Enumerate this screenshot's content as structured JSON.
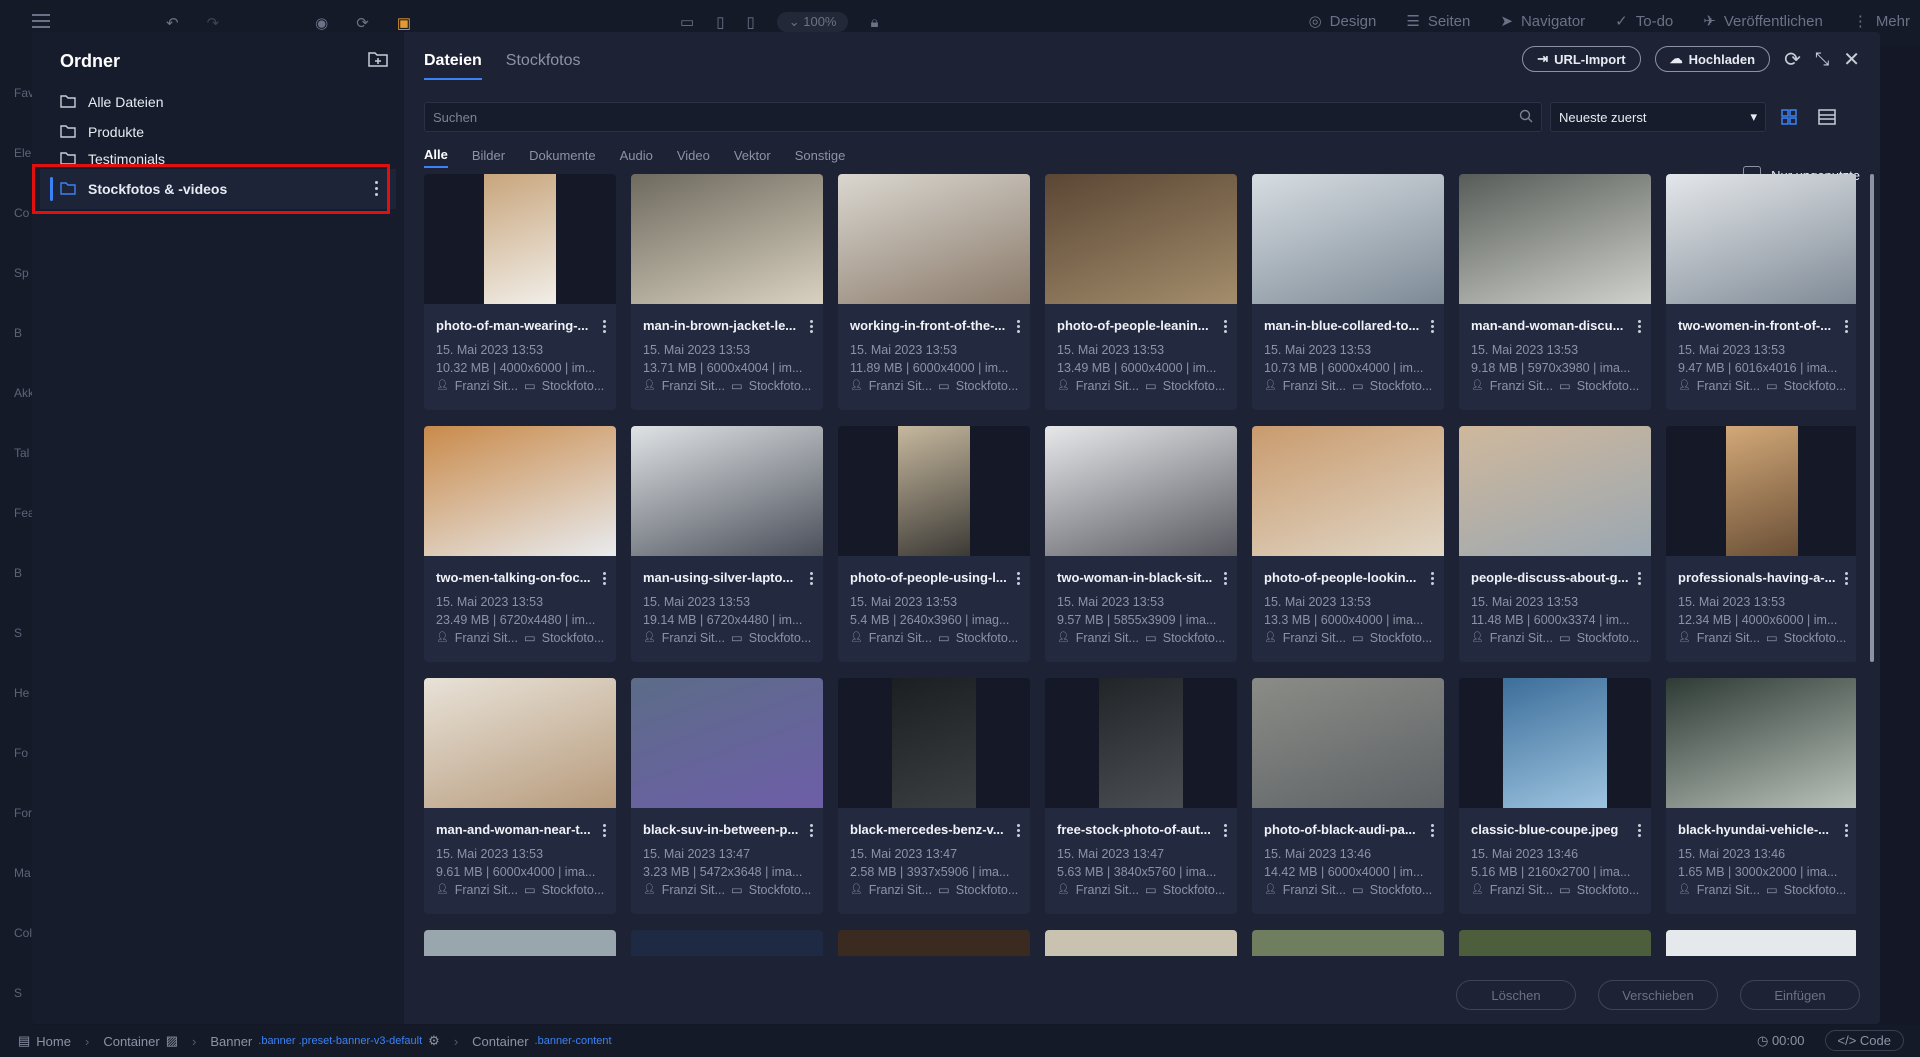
{
  "topbar": {
    "zoom": "100%",
    "items": [
      "Design",
      "Seiten",
      "Navigator",
      "To-do",
      "Veröffentlichen",
      "Mehr"
    ]
  },
  "leftrail": [
    "Fav",
    "Ele",
    "Co",
    "Sp",
    "B",
    "Akk",
    "Tal",
    "Fea",
    "B",
    "S",
    "He",
    "Fo",
    "For",
    "Ma",
    "Coll",
    "S"
  ],
  "folders": {
    "title": "Ordner",
    "items": [
      {
        "label": "Alle Dateien"
      },
      {
        "label": "Produkte"
      },
      {
        "label": "Testimonials"
      },
      {
        "label": "Stockfotos & -videos"
      }
    ]
  },
  "main": {
    "tabs": [
      "Dateien",
      "Stockfotos"
    ],
    "url_import": "URL-Import",
    "upload": "Hochladen",
    "search_placeholder": "Suchen",
    "sort": "Neueste zuerst",
    "filters": [
      "Alle",
      "Bilder",
      "Dokumente",
      "Audio",
      "Video",
      "Vektor",
      "Sonstige"
    ],
    "unused_label": "Nur ungenutzte"
  },
  "files": [
    {
      "name": "photo-of-man-wearing-...",
      "date": "15. Mai 2023 13:53",
      "info": "10.32 MB | 4000x6000 | im...",
      "author": "Franzi Sit...",
      "folder": "Stockfoto..."
    },
    {
      "name": "man-in-brown-jacket-le...",
      "date": "15. Mai 2023 13:53",
      "info": "13.71 MB | 6000x4004 | im...",
      "author": "Franzi Sit...",
      "folder": "Stockfoto..."
    },
    {
      "name": "working-in-front-of-the-...",
      "date": "15. Mai 2023 13:53",
      "info": "11.89 MB | 6000x4000 | im...",
      "author": "Franzi Sit...",
      "folder": "Stockfoto..."
    },
    {
      "name": "photo-of-people-leanin...",
      "date": "15. Mai 2023 13:53",
      "info": "13.49 MB | 6000x4000 | im...",
      "author": "Franzi Sit...",
      "folder": "Stockfoto..."
    },
    {
      "name": "man-in-blue-collared-to...",
      "date": "15. Mai 2023 13:53",
      "info": "10.73 MB | 6000x4000 | im...",
      "author": "Franzi Sit...",
      "folder": "Stockfoto..."
    },
    {
      "name": "man-and-woman-discu...",
      "date": "15. Mai 2023 13:53",
      "info": "9.18 MB | 5970x3980 | ima...",
      "author": "Franzi Sit...",
      "folder": "Stockfoto..."
    },
    {
      "name": "two-women-in-front-of-...",
      "date": "15. Mai 2023 13:53",
      "info": "9.47 MB | 6016x4016 | ima...",
      "author": "Franzi Sit...",
      "folder": "Stockfoto..."
    },
    {
      "name": "two-men-talking-on-foc...",
      "date": "15. Mai 2023 13:53",
      "info": "23.49 MB | 6720x4480 | im...",
      "author": "Franzi Sit...",
      "folder": "Stockfoto..."
    },
    {
      "name": "man-using-silver-lapto...",
      "date": "15. Mai 2023 13:53",
      "info": "19.14 MB | 6720x4480 | im...",
      "author": "Franzi Sit...",
      "folder": "Stockfoto..."
    },
    {
      "name": "photo-of-people-using-l...",
      "date": "15. Mai 2023 13:53",
      "info": "5.4 MB | 2640x3960 | imag...",
      "author": "Franzi Sit...",
      "folder": "Stockfoto..."
    },
    {
      "name": "two-woman-in-black-sit...",
      "date": "15. Mai 2023 13:53",
      "info": "9.57 MB | 5855x3909 | ima...",
      "author": "Franzi Sit...",
      "folder": "Stockfoto..."
    },
    {
      "name": "photo-of-people-lookin...",
      "date": "15. Mai 2023 13:53",
      "info": "13.3 MB | 6000x4000 | ima...",
      "author": "Franzi Sit...",
      "folder": "Stockfoto..."
    },
    {
      "name": "people-discuss-about-g...",
      "date": "15. Mai 2023 13:53",
      "info": "11.48 MB | 6000x3374 | im...",
      "author": "Franzi Sit...",
      "folder": "Stockfoto..."
    },
    {
      "name": "professionals-having-a-...",
      "date": "15. Mai 2023 13:53",
      "info": "12.34 MB | 4000x6000 | im...",
      "author": "Franzi Sit...",
      "folder": "Stockfoto..."
    },
    {
      "name": "man-and-woman-near-t...",
      "date": "15. Mai 2023 13:53",
      "info": "9.61 MB | 6000x4000 | ima...",
      "author": "Franzi Sit...",
      "folder": "Stockfoto..."
    },
    {
      "name": "black-suv-in-between-p...",
      "date": "15. Mai 2023 13:47",
      "info": "3.23 MB | 5472x3648 | ima...",
      "author": "Franzi Sit...",
      "folder": "Stockfoto..."
    },
    {
      "name": "black-mercedes-benz-v...",
      "date": "15. Mai 2023 13:47",
      "info": "2.58 MB | 3937x5906 | ima...",
      "author": "Franzi Sit...",
      "folder": "Stockfoto..."
    },
    {
      "name": "free-stock-photo-of-aut...",
      "date": "15. Mai 2023 13:47",
      "info": "5.63 MB | 3840x5760 | ima...",
      "author": "Franzi Sit...",
      "folder": "Stockfoto..."
    },
    {
      "name": "photo-of-black-audi-pa...",
      "date": "15. Mai 2023 13:46",
      "info": "14.42 MB | 6000x4000 | im...",
      "author": "Franzi Sit...",
      "folder": "Stockfoto..."
    },
    {
      "name": "classic-blue-coupe.jpeg",
      "date": "15. Mai 2023 13:46",
      "info": "5.16 MB | 2160x2700 | ima...",
      "author": "Franzi Sit...",
      "folder": "Stockfoto..."
    },
    {
      "name": "black-hyundai-vehicle-...",
      "date": "15. Mai 2023 13:46",
      "info": "1.65 MB | 3000x2000 | ima...",
      "author": "Franzi Sit...",
      "folder": "Stockfoto..."
    }
  ],
  "footer": {
    "delete": "Löschen",
    "move": "Verschieben",
    "insert": "Einfügen"
  },
  "bottombar": {
    "crumbs": [
      {
        "label": "Home",
        "cls": ""
      },
      {
        "label": "Container",
        "cls": ""
      },
      {
        "label": "Banner",
        "cls": ".banner .preset-banner-v3-default"
      },
      {
        "label": "Container",
        "cls": ".banner-content"
      }
    ],
    "time": "00:00",
    "code": "Code"
  }
}
